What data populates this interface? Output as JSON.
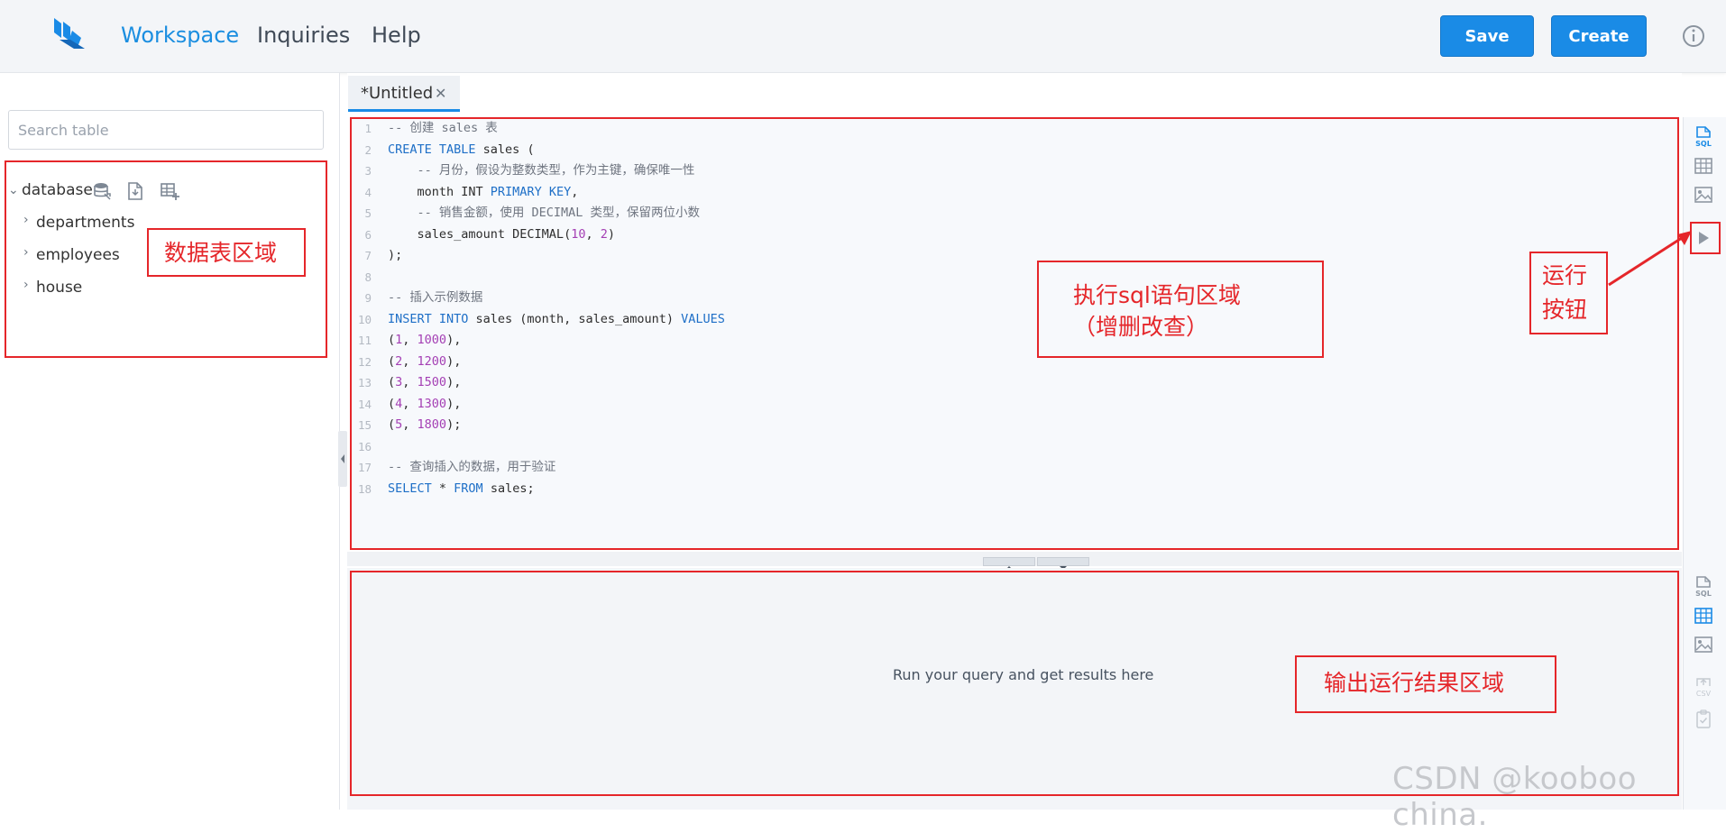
{
  "header": {
    "nav": [
      "Workspace",
      "Inquiries",
      "Help"
    ],
    "active_nav": "Workspace",
    "save_label": "Save",
    "create_label": "Create",
    "accent_color": "#1a8be6"
  },
  "sidebar": {
    "search_placeholder": "Search table",
    "root_label": "database",
    "tables": [
      "departments",
      "employees",
      "house"
    ]
  },
  "tabs": [
    {
      "label": "*Untitled"
    }
  ],
  "editor": {
    "lines": [
      [
        {
          "t": "-- 创建 sales 表",
          "c": "com"
        }
      ],
      [
        {
          "t": "CREATE TABLE",
          "c": "kw"
        },
        {
          "t": " sales (",
          "c": "id"
        }
      ],
      [
        {
          "t": "    -- 月份，假设为整数类型，作为主键，确保唯一性",
          "c": "com"
        }
      ],
      [
        {
          "t": "    month INT ",
          "c": "id"
        },
        {
          "t": "PRIMARY KEY",
          "c": "kw"
        },
        {
          "t": ",",
          "c": "id"
        }
      ],
      [
        {
          "t": "    -- 销售金额，使用 DECIMAL 类型，保留两位小数",
          "c": "com"
        }
      ],
      [
        {
          "t": "    sales_amount DECIMAL(",
          "c": "id"
        },
        {
          "t": "10",
          "c": "num"
        },
        {
          "t": ", ",
          "c": "id"
        },
        {
          "t": "2",
          "c": "num"
        },
        {
          "t": ")",
          "c": "id"
        }
      ],
      [
        {
          "t": ");",
          "c": "id"
        }
      ],
      [],
      [
        {
          "t": "-- 插入示例数据",
          "c": "com"
        }
      ],
      [
        {
          "t": "INSERT INTO",
          "c": "kw"
        },
        {
          "t": " sales (month, sales_amount) ",
          "c": "id"
        },
        {
          "t": "VALUES",
          "c": "kw"
        }
      ],
      [
        {
          "t": "(",
          "c": "id"
        },
        {
          "t": "1",
          "c": "num"
        },
        {
          "t": ", ",
          "c": "id"
        },
        {
          "t": "1000",
          "c": "num"
        },
        {
          "t": "),",
          "c": "id"
        }
      ],
      [
        {
          "t": "(",
          "c": "id"
        },
        {
          "t": "2",
          "c": "num"
        },
        {
          "t": ", ",
          "c": "id"
        },
        {
          "t": "1200",
          "c": "num"
        },
        {
          "t": "),",
          "c": "id"
        }
      ],
      [
        {
          "t": "(",
          "c": "id"
        },
        {
          "t": "3",
          "c": "num"
        },
        {
          "t": ", ",
          "c": "id"
        },
        {
          "t": "1500",
          "c": "num"
        },
        {
          "t": "),",
          "c": "id"
        }
      ],
      [
        {
          "t": "(",
          "c": "id"
        },
        {
          "t": "4",
          "c": "num"
        },
        {
          "t": ", ",
          "c": "id"
        },
        {
          "t": "1300",
          "c": "num"
        },
        {
          "t": "),",
          "c": "id"
        }
      ],
      [
        {
          "t": "(",
          "c": "id"
        },
        {
          "t": "5",
          "c": "num"
        },
        {
          "t": ", ",
          "c": "id"
        },
        {
          "t": "1800",
          "c": "num"
        },
        {
          "t": ");",
          "c": "id"
        }
      ],
      [],
      [
        {
          "t": "-- 查询插入的数据，用于验证",
          "c": "com"
        }
      ],
      [
        {
          "t": "SELECT",
          "c": "kw"
        },
        {
          "t": " * ",
          "c": "id"
        },
        {
          "t": "FROM",
          "c": "kw"
        },
        {
          "t": " sales;",
          "c": "id"
        }
      ]
    ]
  },
  "results": {
    "empty_message": "Run your query and get results here"
  },
  "annotations": {
    "table_area": "数据表区域",
    "sql_area_line1": "执行sql语句区域",
    "sql_area_line2": "（增删改查）",
    "run_button_line1": "运行",
    "run_button_line2": "按钮",
    "output_area": "输出运行结果区域",
    "color": "#e5262a"
  },
  "watermark": "CSDN @kooboo china."
}
